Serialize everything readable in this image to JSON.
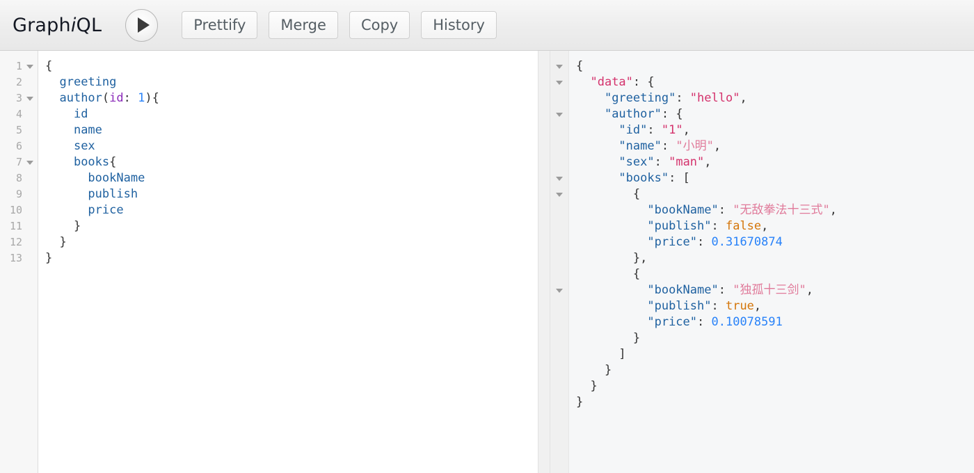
{
  "app": {
    "logo_prefix": "Graph",
    "logo_italic": "i",
    "logo_suffix": "QL"
  },
  "toolbar": {
    "execute_label": "execute-query",
    "buttons": [
      {
        "label": "Prettify",
        "name": "prettify-button"
      },
      {
        "label": "Merge",
        "name": "merge-button"
      },
      {
        "label": "Copy",
        "name": "copy-button"
      },
      {
        "label": "History",
        "name": "history-button"
      }
    ]
  },
  "query_editor": {
    "line_numbers": [
      "1",
      "2",
      "3",
      "4",
      "5",
      "6",
      "7",
      "8",
      "9",
      "10",
      "11",
      "12",
      "13"
    ],
    "fold_lines": [
      1,
      3,
      7
    ],
    "lines": [
      [
        {
          "t": "{",
          "c": "s-punct"
        }
      ],
      [
        {
          "t": "  ",
          "c": "s-punct"
        },
        {
          "t": "greeting",
          "c": "s-field"
        }
      ],
      [
        {
          "t": "  ",
          "c": "s-punct"
        },
        {
          "t": "author",
          "c": "s-field"
        },
        {
          "t": "(",
          "c": "s-punct"
        },
        {
          "t": "id",
          "c": "s-arg"
        },
        {
          "t": ": ",
          "c": "s-punct"
        },
        {
          "t": "1",
          "c": "s-num"
        },
        {
          "t": "){",
          "c": "s-punct"
        }
      ],
      [
        {
          "t": "    ",
          "c": "s-punct"
        },
        {
          "t": "id",
          "c": "s-field"
        }
      ],
      [
        {
          "t": "    ",
          "c": "s-punct"
        },
        {
          "t": "name",
          "c": "s-field"
        }
      ],
      [
        {
          "t": "    ",
          "c": "s-punct"
        },
        {
          "t": "sex",
          "c": "s-field"
        }
      ],
      [
        {
          "t": "    ",
          "c": "s-punct"
        },
        {
          "t": "books",
          "c": "s-field"
        },
        {
          "t": "{",
          "c": "s-punct"
        }
      ],
      [
        {
          "t": "      ",
          "c": "s-punct"
        },
        {
          "t": "bookName",
          "c": "s-field"
        }
      ],
      [
        {
          "t": "      ",
          "c": "s-punct"
        },
        {
          "t": "publish",
          "c": "s-field"
        }
      ],
      [
        {
          "t": "      ",
          "c": "s-punct"
        },
        {
          "t": "price",
          "c": "s-field"
        }
      ],
      [
        {
          "t": "    }",
          "c": "s-punct"
        }
      ],
      [
        {
          "t": "  }",
          "c": "s-punct"
        }
      ],
      [
        {
          "t": "}",
          "c": "s-punct"
        }
      ]
    ],
    "query_text": "{\n  greeting\n  author(id: 1){\n    id\n    name\n    sex\n    books{\n      bookName\n      publish\n      price\n    }\n  }\n}"
  },
  "result_viewer": {
    "fold_lines": [
      1,
      2,
      4,
      8,
      9,
      15
    ],
    "total_lines": 23,
    "lines": [
      [
        {
          "t": "{",
          "c": "r-punct"
        }
      ],
      [
        {
          "t": "  ",
          "c": "r-punct"
        },
        {
          "t": "\"data\"",
          "c": "r-rootkey"
        },
        {
          "t": ": {",
          "c": "r-punct"
        }
      ],
      [
        {
          "t": "    ",
          "c": "r-punct"
        },
        {
          "t": "\"greeting\"",
          "c": "r-key"
        },
        {
          "t": ": ",
          "c": "r-punct"
        },
        {
          "t": "\"hello\"",
          "c": "r-str"
        },
        {
          "t": ",",
          "c": "r-punct"
        }
      ],
      [
        {
          "t": "    ",
          "c": "r-punct"
        },
        {
          "t": "\"author\"",
          "c": "r-key"
        },
        {
          "t": ": {",
          "c": "r-punct"
        }
      ],
      [
        {
          "t": "      ",
          "c": "r-punct"
        },
        {
          "t": "\"id\"",
          "c": "r-key"
        },
        {
          "t": ": ",
          "c": "r-punct"
        },
        {
          "t": "\"1\"",
          "c": "r-str"
        },
        {
          "t": ",",
          "c": "r-punct"
        }
      ],
      [
        {
          "t": "      ",
          "c": "r-punct"
        },
        {
          "t": "\"name\"",
          "c": "r-key"
        },
        {
          "t": ": ",
          "c": "r-punct"
        },
        {
          "t": "\"小明\"",
          "c": "r-strcjk"
        },
        {
          "t": ",",
          "c": "r-punct"
        }
      ],
      [
        {
          "t": "      ",
          "c": "r-punct"
        },
        {
          "t": "\"sex\"",
          "c": "r-key"
        },
        {
          "t": ": ",
          "c": "r-punct"
        },
        {
          "t": "\"man\"",
          "c": "r-str"
        },
        {
          "t": ",",
          "c": "r-punct"
        }
      ],
      [
        {
          "t": "      ",
          "c": "r-punct"
        },
        {
          "t": "\"books\"",
          "c": "r-key"
        },
        {
          "t": ": [",
          "c": "r-punct"
        }
      ],
      [
        {
          "t": "        {",
          "c": "r-punct"
        }
      ],
      [
        {
          "t": "          ",
          "c": "r-punct"
        },
        {
          "t": "\"bookName\"",
          "c": "r-key"
        },
        {
          "t": ": ",
          "c": "r-punct"
        },
        {
          "t": "\"无敌拳法十三式\"",
          "c": "r-strcjk"
        },
        {
          "t": ",",
          "c": "r-punct"
        }
      ],
      [
        {
          "t": "          ",
          "c": "r-punct"
        },
        {
          "t": "\"publish\"",
          "c": "r-key"
        },
        {
          "t": ": ",
          "c": "r-punct"
        },
        {
          "t": "false",
          "c": "r-bool"
        },
        {
          "t": ",",
          "c": "r-punct"
        }
      ],
      [
        {
          "t": "          ",
          "c": "r-punct"
        },
        {
          "t": "\"price\"",
          "c": "r-key"
        },
        {
          "t": ": ",
          "c": "r-punct"
        },
        {
          "t": "0.31670874",
          "c": "r-num"
        }
      ],
      [
        {
          "t": "        },",
          "c": "r-punct"
        }
      ],
      [
        {
          "t": "        {",
          "c": "r-punct"
        }
      ],
      [
        {
          "t": "          ",
          "c": "r-punct"
        },
        {
          "t": "\"bookName\"",
          "c": "r-key"
        },
        {
          "t": ": ",
          "c": "r-punct"
        },
        {
          "t": "\"独孤十三剑\"",
          "c": "r-strcjk"
        },
        {
          "t": ",",
          "c": "r-punct"
        }
      ],
      [
        {
          "t": "          ",
          "c": "r-punct"
        },
        {
          "t": "\"publish\"",
          "c": "r-key"
        },
        {
          "t": ": ",
          "c": "r-punct"
        },
        {
          "t": "true",
          "c": "r-bool"
        },
        {
          "t": ",",
          "c": "r-punct"
        }
      ],
      [
        {
          "t": "          ",
          "c": "r-punct"
        },
        {
          "t": "\"price\"",
          "c": "r-key"
        },
        {
          "t": ": ",
          "c": "r-punct"
        },
        {
          "t": "0.10078591",
          "c": "r-num"
        }
      ],
      [
        {
          "t": "        }",
          "c": "r-punct"
        }
      ],
      [
        {
          "t": "      ]",
          "c": "r-punct"
        }
      ],
      [
        {
          "t": "    }",
          "c": "r-punct"
        }
      ],
      [
        {
          "t": "  }",
          "c": "r-punct"
        }
      ],
      [
        {
          "t": "}",
          "c": "r-punct"
        }
      ]
    ],
    "response": {
      "data": {
        "greeting": "hello",
        "author": {
          "id": "1",
          "name": "小明",
          "sex": "man",
          "books": [
            {
              "bookName": "无敌拳法十三式",
              "publish": false,
              "price": 0.31670874
            },
            {
              "bookName": "独孤十三剑",
              "publish": true,
              "price": 0.10078591
            }
          ]
        }
      }
    }
  },
  "colors": {
    "field": "#1f61a0",
    "argument": "#8b2bb9",
    "number": "#2882f9",
    "string": "#d4326c",
    "boolean": "#d47509",
    "punctuation": "#333333",
    "toolbar_bg": "#eeeeee",
    "result_bg": "#f6f7f8",
    "gutter_bg": "#f7f7f7"
  }
}
